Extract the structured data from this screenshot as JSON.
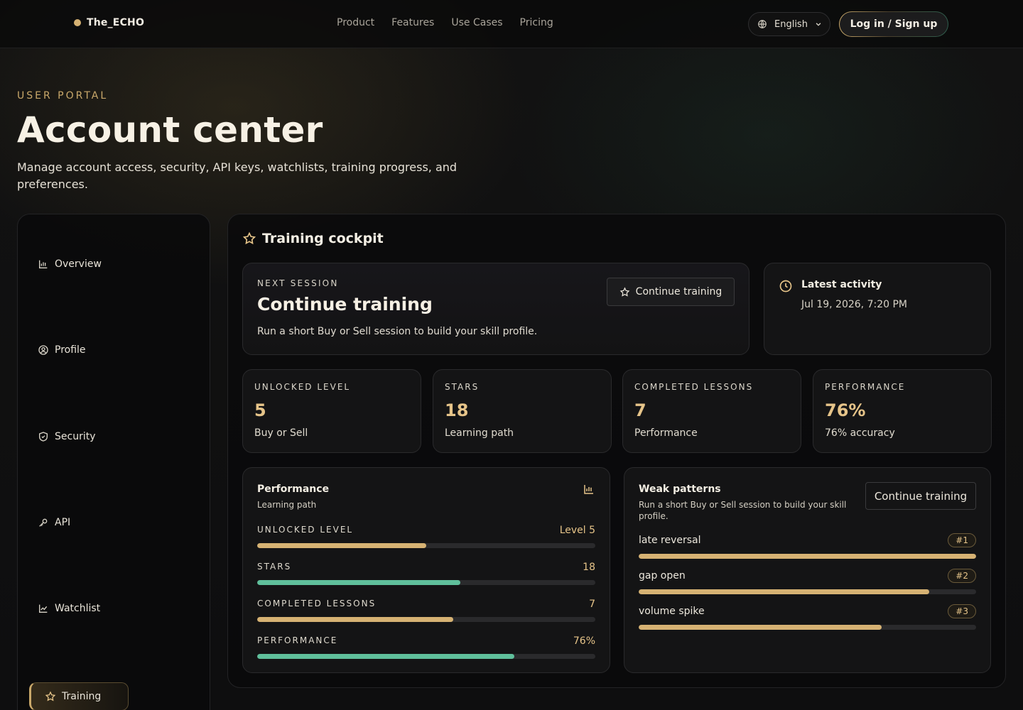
{
  "header": {
    "brand": "The_ECHO",
    "nav": [
      "Product",
      "Features",
      "Use Cases",
      "Pricing"
    ],
    "language": "English",
    "login_label": "Log in / Sign up"
  },
  "hero": {
    "eyebrow": "USER PORTAL",
    "title": "Account center",
    "subtitle": "Manage account access, security, API keys, watchlists, training progress, and preferences."
  },
  "sidebar": {
    "items": [
      {
        "label": "Overview",
        "icon": "bar-chart-icon"
      },
      {
        "label": "Profile",
        "icon": "user-circle-icon"
      },
      {
        "label": "Security",
        "icon": "shield-icon"
      },
      {
        "label": "API",
        "icon": "key-icon"
      },
      {
        "label": "Watchlist",
        "icon": "line-chart-icon"
      },
      {
        "label": "Training",
        "icon": "star-icon",
        "active": true
      }
    ]
  },
  "main": {
    "title": "Training cockpit",
    "next_session": {
      "eyebrow": "NEXT SESSION",
      "title": "Continue training",
      "description": "Run a short Buy or Sell session to build your skill profile.",
      "button": "Continue training"
    },
    "activity": {
      "title": "Latest activity",
      "timestamp": "Jul 19, 2026, 7:20 PM"
    },
    "stats": [
      {
        "label": "UNLOCKED LEVEL",
        "value": "5",
        "sub": "Buy or Sell"
      },
      {
        "label": "STARS",
        "value": "18",
        "sub": "Learning path"
      },
      {
        "label": "COMPLETED LESSONS",
        "value": "7",
        "sub": "Performance"
      },
      {
        "label": "PERFORMANCE",
        "value": "76%",
        "sub": "76% accuracy"
      }
    ],
    "performance": {
      "title": "Performance",
      "subtitle": "Learning path",
      "metrics": [
        {
          "label": "UNLOCKED LEVEL",
          "value": "Level 5",
          "fraction": 0.5,
          "color": "#d6b273"
        },
        {
          "label": "STARS",
          "value": "18",
          "fraction": 0.6,
          "color": "#5fbf9b"
        },
        {
          "label": "COMPLETED LESSONS",
          "value": "7",
          "fraction": 0.58,
          "color": "#d6b273"
        },
        {
          "label": "PERFORMANCE",
          "value": "76%",
          "fraction": 0.76,
          "color": "#5fbf9b"
        }
      ]
    },
    "weak_patterns": {
      "title": "Weak patterns",
      "description": "Run a short Buy or Sell session to build your skill profile.",
      "button": "Continue training",
      "items": [
        {
          "name": "late reversal",
          "rank": "#1",
          "fraction": 1.0
        },
        {
          "name": "gap open",
          "rank": "#2",
          "fraction": 0.86
        },
        {
          "name": "volume spike",
          "rank": "#3",
          "fraction": 0.72
        }
      ]
    }
  },
  "colors": {
    "accent": "#d6b273",
    "green": "#5fbf9b"
  }
}
